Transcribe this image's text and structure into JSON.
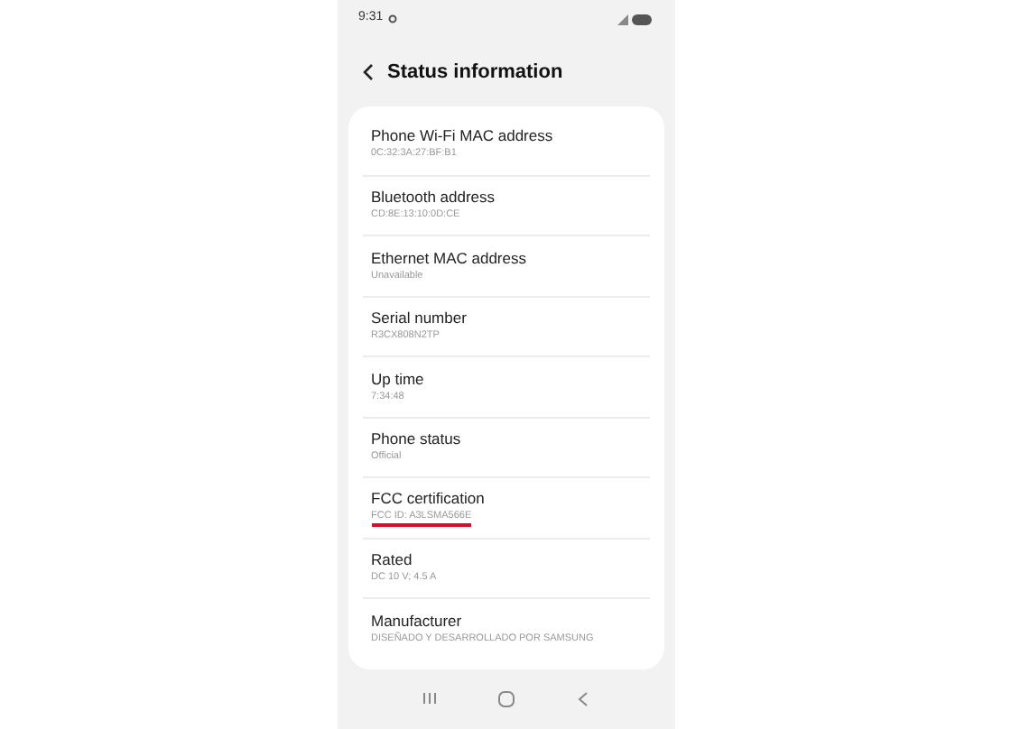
{
  "status_bar": {
    "time": "9:31"
  },
  "header": {
    "title": "Status information"
  },
  "items": [
    {
      "label": "Phone Wi-Fi MAC address",
      "value": "0C:32:3A:27:BF:B1",
      "underlined": false
    },
    {
      "label": "Bluetooth address",
      "value": "CD:8E:13:10:0D:CE",
      "underlined": false
    },
    {
      "label": "Ethernet MAC address",
      "value": "Unavailable",
      "underlined": false
    },
    {
      "label": "Serial number",
      "value": "R3CX808N2TP",
      "underlined": false
    },
    {
      "label": "Up time",
      "value": "7:34:48",
      "underlined": false
    },
    {
      "label": "Phone status",
      "value": "Official",
      "underlined": false
    },
    {
      "label": "FCC certification",
      "value": "FCC ID: A3LSMA566E",
      "underlined": true
    },
    {
      "label": "Rated",
      "value": "DC 10 V; 4.5 A",
      "underlined": false
    },
    {
      "label": "Manufacturer",
      "value": "DISEÑADO Y DESARROLLADO POR SAMSUNG",
      "underlined": false
    }
  ]
}
